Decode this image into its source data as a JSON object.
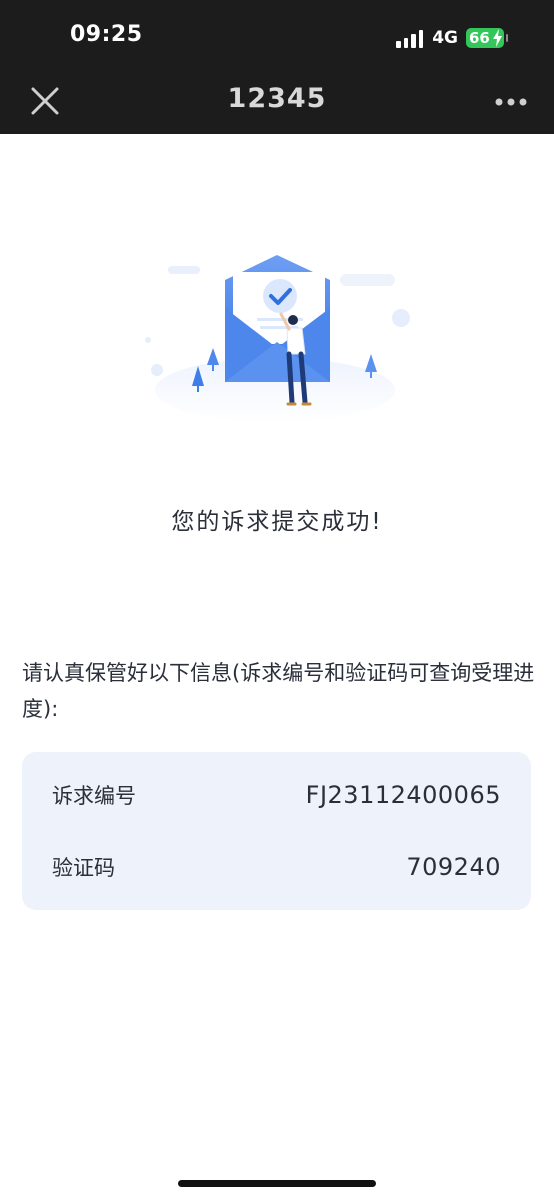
{
  "status_bar": {
    "time": "09:25",
    "network": "4G",
    "battery": "66",
    "battery_color": "#33c759"
  },
  "nav": {
    "title": "12345",
    "close_icon": "close-icon",
    "more_icon": "more-icon"
  },
  "illustration": {
    "icon": "envelope-checkmark-illustration",
    "accent_color": "#3f7ee8"
  },
  "result": {
    "message": "您的诉求提交成功!"
  },
  "notice": {
    "text": "请认真保管好以下信息(诉求编号和验证码可查询受理进度):"
  },
  "info": {
    "rows": [
      {
        "label": "诉求编号",
        "value": "FJ23112400065"
      },
      {
        "label": "验证码",
        "value": "709240"
      }
    ]
  }
}
